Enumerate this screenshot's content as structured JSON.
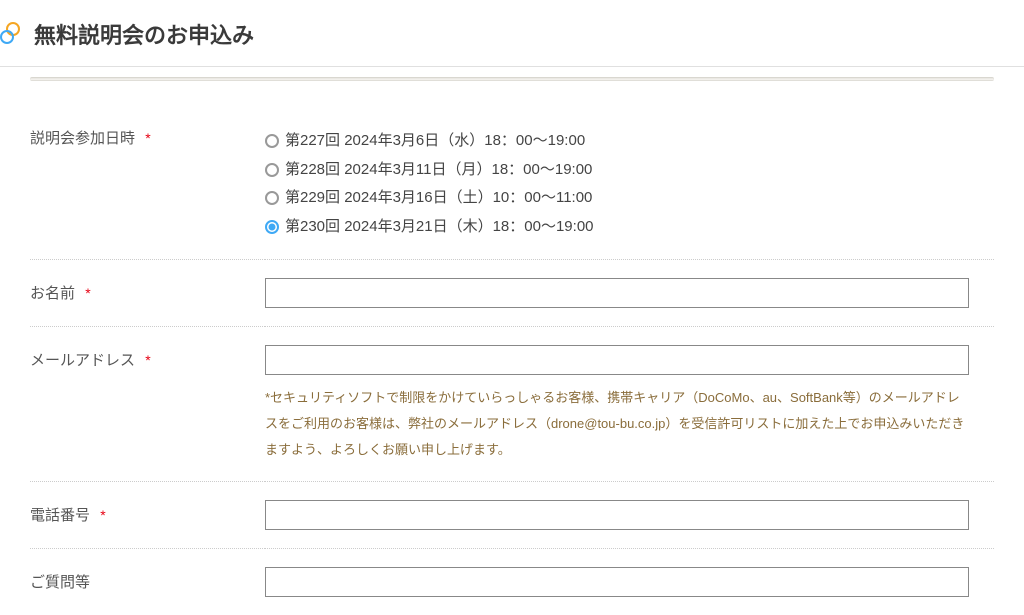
{
  "page_title": "無料説明会のお申込み",
  "required_mark": "*",
  "fields": {
    "date": {
      "label": "説明会参加日時",
      "options": [
        {
          "label": "第227回 2024年3月6日（水）18：00〜19:00",
          "selected": false
        },
        {
          "label": "第228回 2024年3月11日（月）18：00〜19:00",
          "selected": false
        },
        {
          "label": "第229回 2024年3月16日（土）10：00〜11:00",
          "selected": false
        },
        {
          "label": "第230回 2024年3月21日（木）18：00〜19:00",
          "selected": true
        }
      ]
    },
    "name": {
      "label": "お名前",
      "value": ""
    },
    "email": {
      "label": "メールアドレス",
      "value": "",
      "helper": "*セキュリティソフトで制限をかけていらっしゃるお客様、携帯キャリア（DoCoMo、au、SoftBank等）のメールアドレスをご利用のお客様は、弊社のメールアドレス（drone@tou-bu.co.jp）を受信許可リストに加えた上でお申込みいただきますよう、よろしくお願い申し上げます。"
    },
    "phone": {
      "label": "電話番号",
      "value": ""
    },
    "question": {
      "label": "ご質問等",
      "value": ""
    }
  }
}
